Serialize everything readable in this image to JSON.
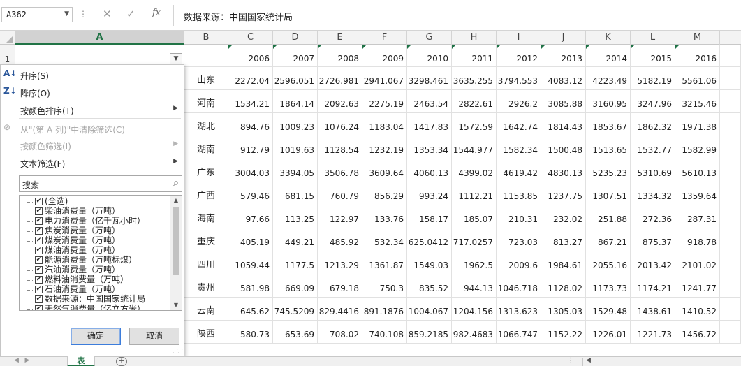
{
  "formula_bar": {
    "name_box": "A362",
    "cancel_glyph": "✕",
    "enter_glyph": "✓",
    "fx_label": "fx",
    "content": "数据来源：中国国家统计局"
  },
  "columns": [
    "A",
    "B",
    "C",
    "D",
    "E",
    "F",
    "G",
    "H",
    "I",
    "J",
    "K",
    "L",
    "M"
  ],
  "row1_number": "1",
  "years": [
    "2006",
    "2007",
    "2008",
    "2009",
    "2010",
    "2011",
    "2012",
    "2013",
    "2014",
    "2015",
    "2016"
  ],
  "rows": [
    {
      "province": "山东",
      "values": [
        "2272.04",
        "2596.051",
        "2726.981",
        "2941.067",
        "3298.461",
        "3635.255",
        "3794.553",
        "4083.12",
        "4223.49",
        "5182.19",
        "5561.06"
      ]
    },
    {
      "province": "河南",
      "values": [
        "1534.21",
        "1864.14",
        "2092.63",
        "2275.19",
        "2463.54",
        "2822.61",
        "2926.2",
        "3085.88",
        "3160.95",
        "3247.96",
        "3215.46"
      ]
    },
    {
      "province": "湖北",
      "values": [
        "894.76",
        "1009.23",
        "1076.24",
        "1183.04",
        "1417.83",
        "1572.59",
        "1642.74",
        "1814.43",
        "1853.67",
        "1862.32",
        "1971.38"
      ]
    },
    {
      "province": "湖南",
      "values": [
        "912.79",
        "1019.63",
        "1128.54",
        "1232.19",
        "1353.34",
        "1544.977",
        "1582.34",
        "1500.48",
        "1513.65",
        "1532.77",
        "1582.99"
      ]
    },
    {
      "province": "广东",
      "values": [
        "3004.03",
        "3394.05",
        "3506.78",
        "3609.64",
        "4060.13",
        "4399.02",
        "4619.42",
        "4830.13",
        "5235.23",
        "5310.69",
        "5610.13"
      ]
    },
    {
      "province": "广西",
      "values": [
        "579.46",
        "681.15",
        "760.79",
        "856.29",
        "993.24",
        "1112.21",
        "1153.85",
        "1237.75",
        "1307.51",
        "1334.32",
        "1359.64"
      ]
    },
    {
      "province": "海南",
      "values": [
        "97.66",
        "113.25",
        "122.97",
        "133.76",
        "158.17",
        "185.07",
        "210.31",
        "232.02",
        "251.88",
        "272.36",
        "287.31"
      ]
    },
    {
      "province": "重庆",
      "values": [
        "405.19",
        "449.21",
        "485.92",
        "532.34",
        "625.0412",
        "717.0257",
        "723.03",
        "813.27",
        "867.21",
        "875.37",
        "918.78"
      ]
    },
    {
      "province": "四川",
      "values": [
        "1059.44",
        "1177.5",
        "1213.29",
        "1361.87",
        "1549.03",
        "1962.5",
        "2009.6",
        "1984.61",
        "2055.16",
        "2013.42",
        "2101.02"
      ]
    },
    {
      "province": "贵州",
      "values": [
        "581.98",
        "669.09",
        "679.18",
        "750.3",
        "835.52",
        "944.13",
        "1046.718",
        "1128.02",
        "1173.73",
        "1174.21",
        "1241.77"
      ]
    },
    {
      "province": "云南",
      "values": [
        "645.62",
        "745.5209",
        "829.4416",
        "891.1876",
        "1004.067",
        "1204.156",
        "1313.623",
        "1305.03",
        "1529.48",
        "1438.61",
        "1410.52"
      ]
    },
    {
      "province": "陕西",
      "values": [
        "580.73",
        "653.69",
        "708.02",
        "740.108",
        "859.2185",
        "982.4683",
        "1066.747",
        "1152.22",
        "1226.01",
        "1221.73",
        "1456.72"
      ]
    }
  ],
  "filter_menu": {
    "sort_asc": "升序(S)",
    "sort_desc": "降序(O)",
    "sort_by_color": "按颜色排序(T)",
    "clear_filter": "从\"(第 A 列)\"中清除筛选(C)",
    "filter_by_color": "按颜色筛选(I)",
    "text_filter": "文本筛选(F)",
    "search_placeholder": "搜索",
    "items": [
      "(全选)",
      "柴油消费量（万吨）",
      "电力消费量（亿千瓦小时）",
      "焦炭消费量（万吨）",
      "煤炭消费量（万吨）",
      "煤油消费量（万吨）",
      "能源消费量（万吨标煤）",
      "汽油消费量（万吨）",
      "燃料油消费量（万吨）",
      "石油消费量（万吨）",
      "数据来源：中国国家统计局",
      "天然气消费量（亿立方米）"
    ],
    "ok_label": "确定",
    "cancel_label": "取消"
  },
  "sheet_tab": "表",
  "add_sheet": "+"
}
